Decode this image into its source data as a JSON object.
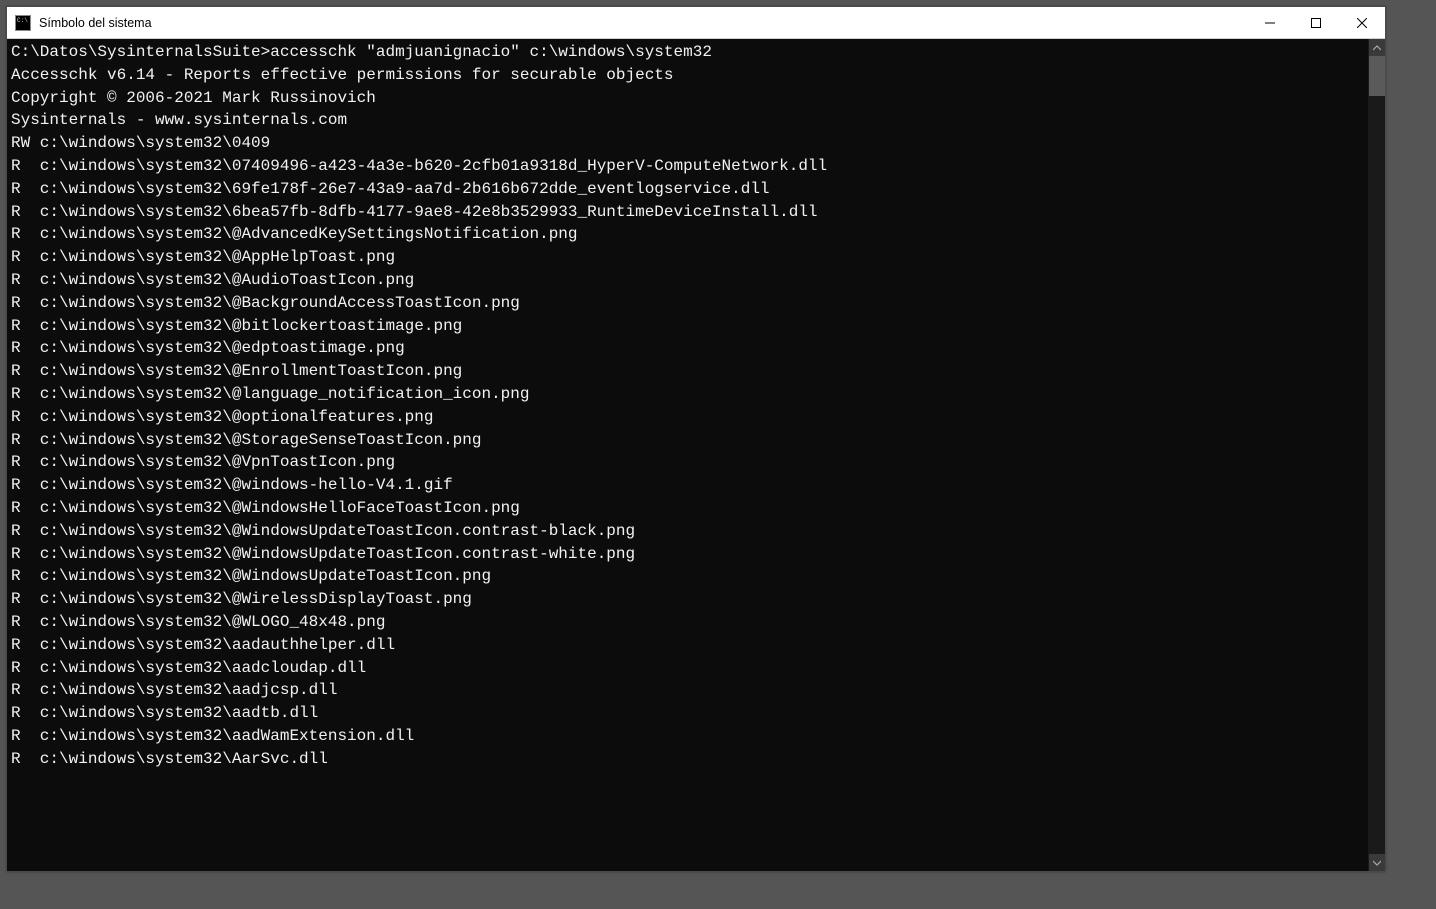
{
  "window": {
    "title": "Símbolo del sistema"
  },
  "terminal": {
    "prompt": "C:\\Datos\\SysinternalsSuite>",
    "command": "accesschk \"admjuanignacio\" c:\\windows\\system32",
    "banner": [
      "Accesschk v6.14 - Reports effective permissions for securable objects",
      "Copyright © 2006-2021 Mark Russinovich",
      "Sysinternals - www.sysinternals.com"
    ],
    "entries": [
      {
        "perm": "RW",
        "path": "c:\\windows\\system32\\0409"
      },
      {
        "perm": "R",
        "path": "c:\\windows\\system32\\07409496-a423-4a3e-b620-2cfb01a9318d_HyperV-ComputeNetwork.dll"
      },
      {
        "perm": "R",
        "path": "c:\\windows\\system32\\69fe178f-26e7-43a9-aa7d-2b616b672dde_eventlogservice.dll"
      },
      {
        "perm": "R",
        "path": "c:\\windows\\system32\\6bea57fb-8dfb-4177-9ae8-42e8b3529933_RuntimeDeviceInstall.dll"
      },
      {
        "perm": "R",
        "path": "c:\\windows\\system32\\@AdvancedKeySettingsNotification.png"
      },
      {
        "perm": "R",
        "path": "c:\\windows\\system32\\@AppHelpToast.png"
      },
      {
        "perm": "R",
        "path": "c:\\windows\\system32\\@AudioToastIcon.png"
      },
      {
        "perm": "R",
        "path": "c:\\windows\\system32\\@BackgroundAccessToastIcon.png"
      },
      {
        "perm": "R",
        "path": "c:\\windows\\system32\\@bitlockertoastimage.png"
      },
      {
        "perm": "R",
        "path": "c:\\windows\\system32\\@edptoastimage.png"
      },
      {
        "perm": "R",
        "path": "c:\\windows\\system32\\@EnrollmentToastIcon.png"
      },
      {
        "perm": "R",
        "path": "c:\\windows\\system32\\@language_notification_icon.png"
      },
      {
        "perm": "R",
        "path": "c:\\windows\\system32\\@optionalfeatures.png"
      },
      {
        "perm": "R",
        "path": "c:\\windows\\system32\\@StorageSenseToastIcon.png"
      },
      {
        "perm": "R",
        "path": "c:\\windows\\system32\\@VpnToastIcon.png"
      },
      {
        "perm": "R",
        "path": "c:\\windows\\system32\\@windows-hello-V4.1.gif"
      },
      {
        "perm": "R",
        "path": "c:\\windows\\system32\\@WindowsHelloFaceToastIcon.png"
      },
      {
        "perm": "R",
        "path": "c:\\windows\\system32\\@WindowsUpdateToastIcon.contrast-black.png"
      },
      {
        "perm": "R",
        "path": "c:\\windows\\system32\\@WindowsUpdateToastIcon.contrast-white.png"
      },
      {
        "perm": "R",
        "path": "c:\\windows\\system32\\@WindowsUpdateToastIcon.png"
      },
      {
        "perm": "R",
        "path": "c:\\windows\\system32\\@WirelessDisplayToast.png"
      },
      {
        "perm": "R",
        "path": "c:\\windows\\system32\\@WLOGO_48x48.png"
      },
      {
        "perm": "R",
        "path": "c:\\windows\\system32\\aadauthhelper.dll"
      },
      {
        "perm": "R",
        "path": "c:\\windows\\system32\\aadcloudap.dll"
      },
      {
        "perm": "R",
        "path": "c:\\windows\\system32\\aadjcsp.dll"
      },
      {
        "perm": "R",
        "path": "c:\\windows\\system32\\aadtb.dll"
      },
      {
        "perm": "R",
        "path": "c:\\windows\\system32\\aadWamExtension.dll"
      },
      {
        "perm": "R",
        "path": "c:\\windows\\system32\\AarSvc.dll"
      }
    ]
  }
}
